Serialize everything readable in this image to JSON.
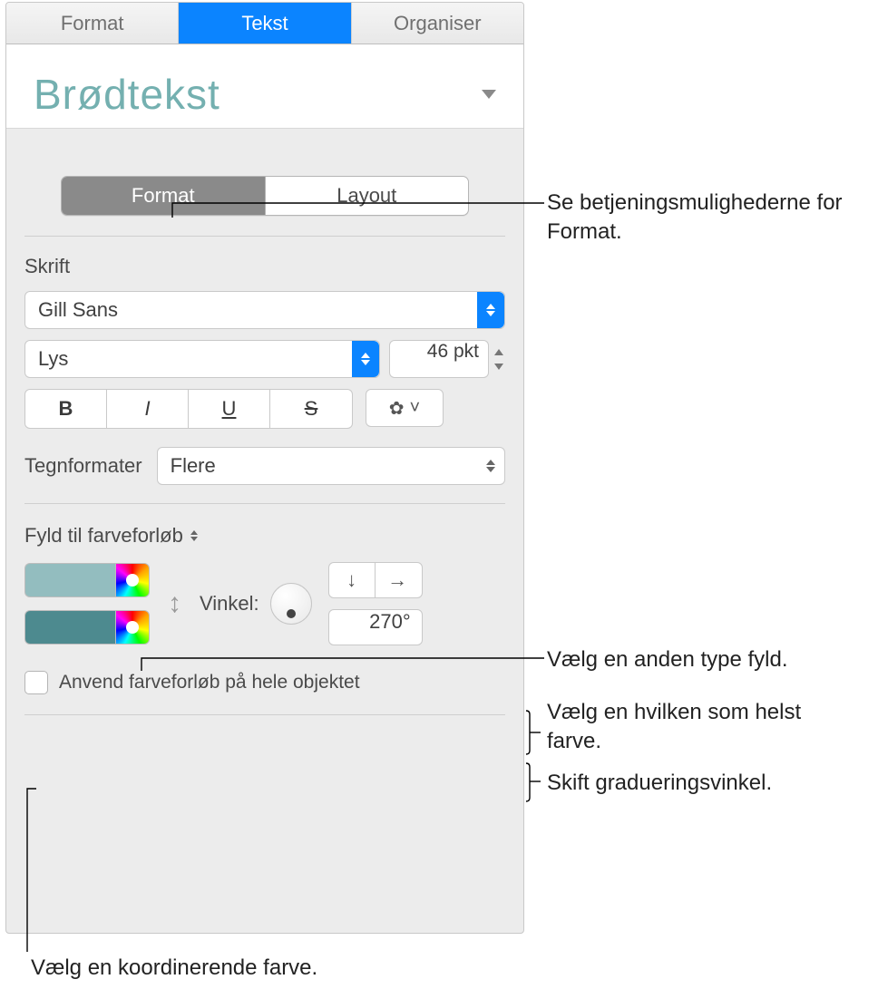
{
  "tabs": {
    "format": "Format",
    "text": "Tekst",
    "organize": "Organiser"
  },
  "style_name": "Brødtekst",
  "segmented": {
    "format": "Format",
    "layout": "Layout"
  },
  "font": {
    "section": "Skrift",
    "family": "Gill Sans",
    "style": "Lys",
    "size": "46 pkt"
  },
  "bius": {
    "bold": "B",
    "italic": "I",
    "underline": "U",
    "strike": "S"
  },
  "char_styles": {
    "label": "Tegnformater",
    "value": "Flere"
  },
  "fill": {
    "label": "Fyld til farveforløb"
  },
  "gradient": {
    "angle_label": "Vinkel:",
    "angle_value": "270°",
    "color0": "#93bdbf",
    "color1": "#4d8a8f"
  },
  "checkbox": {
    "label": "Anvend farveforløb på hele objektet"
  },
  "callouts": {
    "c1": "Se betjeningsmulighederne for Format.",
    "c2": "Vælg en anden type fyld.",
    "c3": "Vælg en hvilken som helst farve.",
    "c4": "Skift gradueringsvinkel.",
    "c5": "Vælg en koordinerende farve."
  }
}
